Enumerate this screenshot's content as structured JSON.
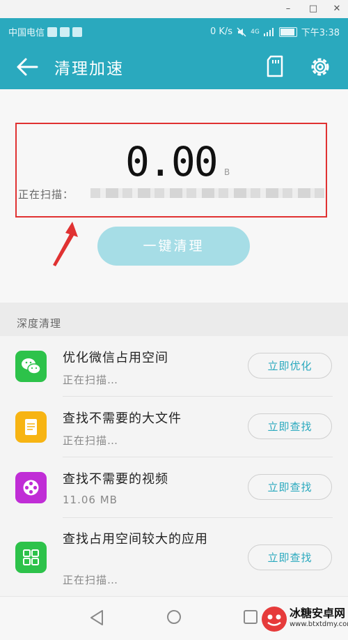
{
  "window": {
    "minimize": "–",
    "maximize": "□",
    "close": "✕"
  },
  "status_bar": {
    "carrier": "中国电信",
    "network_speed": "0 K/s",
    "signal": "4G",
    "time": "下午3:38"
  },
  "app_bar": {
    "title": "清理加速",
    "icons": [
      "back-arrow-icon",
      "sd-card-icon",
      "settings-gear-icon"
    ]
  },
  "scan": {
    "size_value": "0.00",
    "size_unit": "B",
    "scanning_label": "正在扫描：",
    "clean_button": "一键清理"
  },
  "deep_clean": {
    "section_title": "深度清理",
    "items": [
      {
        "title": "优化微信占用空间",
        "subtitle": "正在扫描…",
        "button": "立即优化",
        "icon": "wechat-icon",
        "color": "#2dc24a"
      },
      {
        "title": "查找不需要的大文件",
        "subtitle": "正在扫描…",
        "button": "立即查找",
        "icon": "document-icon",
        "color": "#f7b413"
      },
      {
        "title": "查找不需要的视频",
        "subtitle": "11.06 MB",
        "button": "立即查找",
        "icon": "video-reel-icon",
        "color": "#c02dd6"
      },
      {
        "title": "查找占用空间较大的应用",
        "subtitle": "正在扫描…",
        "button": "立即查找",
        "icon": "apps-grid-icon",
        "color": "#2dc24a"
      }
    ]
  },
  "watermark": {
    "name": "冰糖安卓网",
    "url": "www.btxtdmy.com"
  },
  "colors": {
    "accent": "#2aa9be",
    "highlight": "#e03232"
  }
}
